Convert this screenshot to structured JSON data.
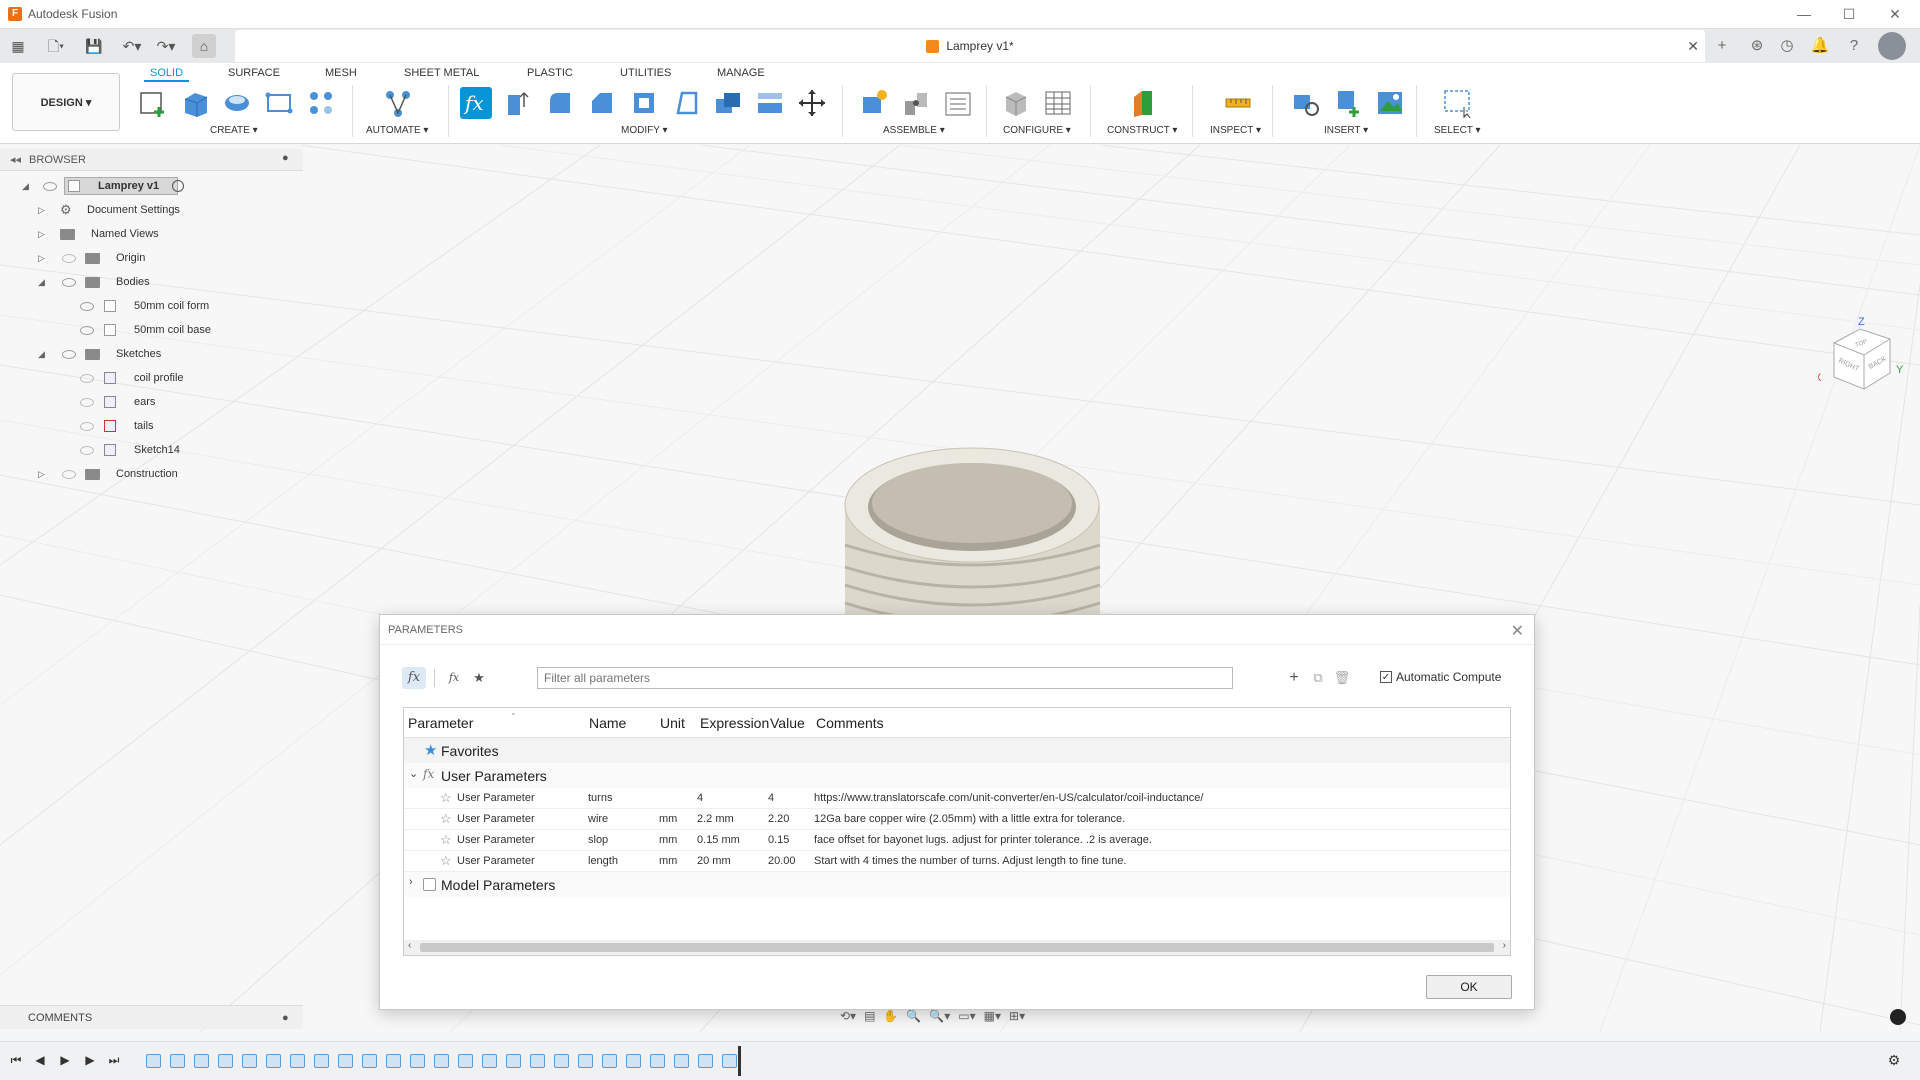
{
  "app": {
    "title": "Autodesk Fusion"
  },
  "document": {
    "tab_title": "Lamprey v1*"
  },
  "ribbon": {
    "workspace": "DESIGN ▾",
    "tabs": [
      "SOLID",
      "SURFACE",
      "MESH",
      "SHEET METAL",
      "PLASTIC",
      "UTILITIES",
      "MANAGE"
    ],
    "active_tab": "SOLID",
    "groups": [
      "CREATE ▾",
      "AUTOMATE ▾",
      "MODIFY ▾",
      "ASSEMBLE ▾",
      "CONFIGURE ▾",
      "CONSTRUCT ▾",
      "INSPECT ▾",
      "INSERT ▾",
      "SELECT ▾"
    ]
  },
  "browser": {
    "title": "BROWSER",
    "items": [
      {
        "label": "Lamprey v1",
        "icon": "document-icon"
      },
      {
        "label": "Document Settings",
        "icon": "gear-icon"
      },
      {
        "label": "Named Views",
        "icon": "folder-icon"
      },
      {
        "label": "Origin",
        "icon": "folder-icon"
      },
      {
        "label": "Bodies",
        "icon": "folder-icon"
      },
      {
        "label": "50mm coil form",
        "icon": "body-icon"
      },
      {
        "label": "50mm coil base",
        "icon": "body-icon"
      },
      {
        "label": "Sketches",
        "icon": "folder-icon"
      },
      {
        "label": "coil profile",
        "icon": "sketch-icon"
      },
      {
        "label": "ears",
        "icon": "sketch-icon"
      },
      {
        "label": "tails",
        "icon": "sketch-icon"
      },
      {
        "label": "Sketch14",
        "icon": "sketch-icon"
      },
      {
        "label": "Construction",
        "icon": "folder-icon"
      }
    ]
  },
  "viewcube": {
    "axis_z": "Z",
    "axis_x": "X",
    "axis_y": "Y",
    "face_right": "RIGHT",
    "face_back": "BACK",
    "face_top": "TOP"
  },
  "comments": {
    "title": "COMMENTS"
  },
  "parameters_dialog": {
    "title": "PARAMETERS",
    "filter_placeholder": "Filter all parameters",
    "auto_compute_label": "Automatic Compute",
    "auto_compute_checked": true,
    "columns": [
      "Parameter",
      "Name",
      "Unit",
      "Expression",
      "Value",
      "Comments"
    ],
    "groups": {
      "favorites": "Favorites",
      "user": "User Parameters",
      "model": "Model Parameters"
    },
    "rows": [
      {
        "parameter": "User Parameter",
        "name": "turns",
        "unit": "",
        "expression": "4",
        "value": "4",
        "comment": "https://www.translatorscafe.com/unit-converter/en-US/calculator/coil-inductance/"
      },
      {
        "parameter": "User Parameter",
        "name": "wire",
        "unit": "mm",
        "expression": "2.2 mm",
        "value": "2.20",
        "comment": "12Ga bare copper wire (2.05mm) with a little extra for tolerance."
      },
      {
        "parameter": "User Parameter",
        "name": "slop",
        "unit": "mm",
        "expression": "0.15 mm",
        "value": "0.15",
        "comment": "face offset for bayonet lugs. adjust for printer tolerance. .2 is average."
      },
      {
        "parameter": "User Parameter",
        "name": "length",
        "unit": "mm",
        "expression": "20 mm",
        "value": "20.00",
        "comment": "Start with 4 times the number of turns. Adjust length to fine tune."
      }
    ],
    "ok_label": "OK"
  },
  "colors": {
    "accent": "#0696d7",
    "model_light": "#e0dcd1",
    "model_red": "#c8102e"
  }
}
